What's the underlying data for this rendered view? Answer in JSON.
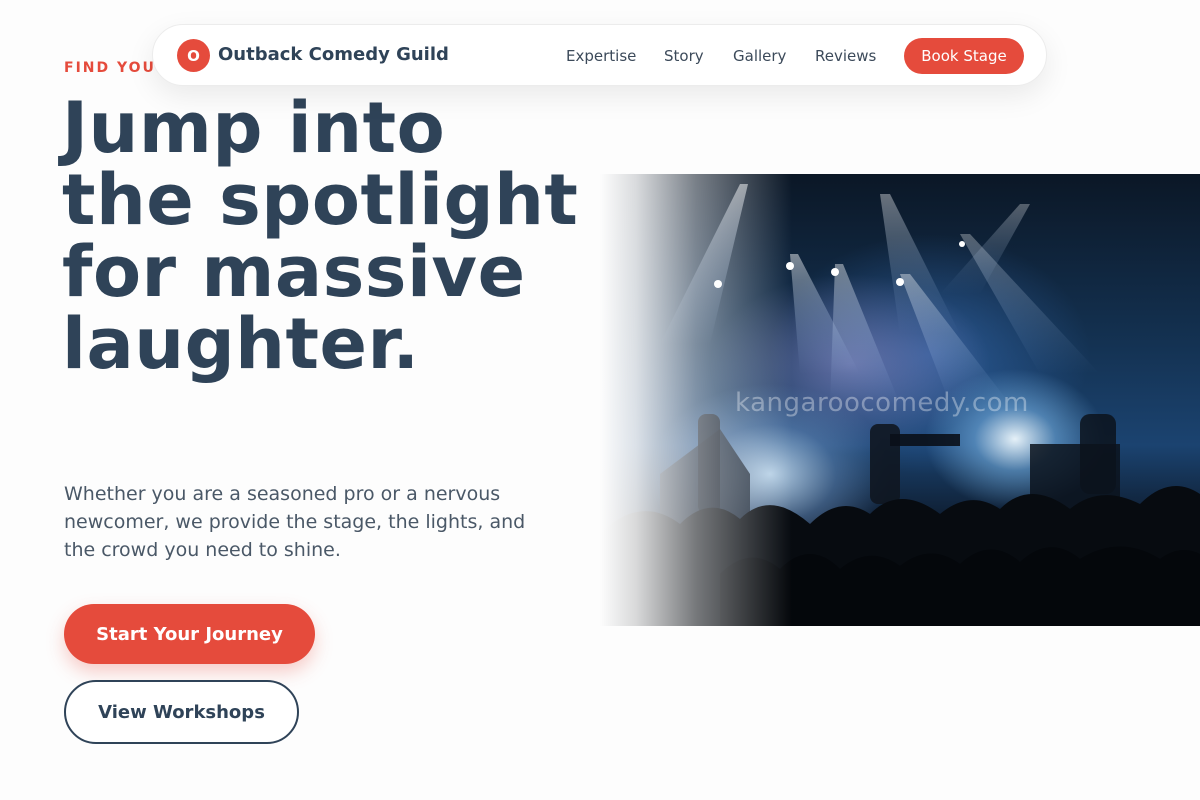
{
  "nav": {
    "brand_initial": "O",
    "brand_name": "Outback Comedy Guild",
    "links": [
      "Expertise",
      "Story",
      "Gallery",
      "Reviews"
    ],
    "cta_label": "Book Stage"
  },
  "hero": {
    "eyebrow": "FIND YOUR",
    "headline": "Jump into the spotlight for massive laughter.",
    "subtext": "Whether you are a seasoned pro or a nervous newcomer, we provide the stage, the lights, and the crowd you need to shine.",
    "primary_cta": "Start Your Journey",
    "secondary_cta": "View Workshops"
  },
  "image": {
    "watermark": "kangaroocomedy.com",
    "description_icon": "concert-stage-photo"
  },
  "colors": {
    "accent": "#e54b3c",
    "navy": "#2f4358",
    "background": "#fdfdfd"
  }
}
